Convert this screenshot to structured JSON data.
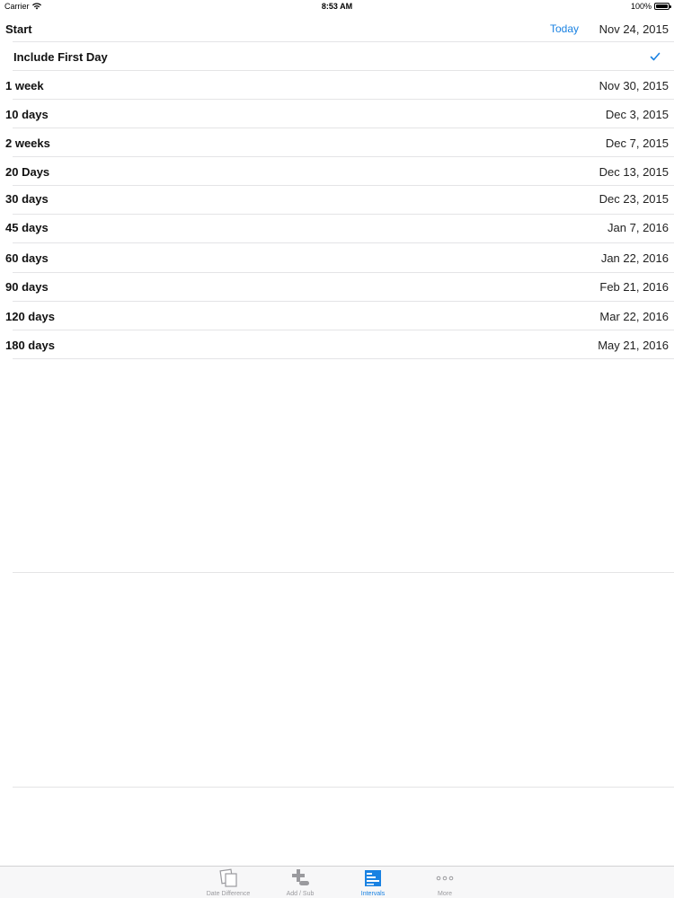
{
  "status_bar": {
    "carrier": "Carrier",
    "time": "8:53 AM",
    "battery": "100%"
  },
  "start_row": {
    "label": "Start",
    "today_button": "Today",
    "date": "Nov 24, 2015"
  },
  "include_first_day": {
    "label": "Include First Day",
    "checked": true
  },
  "intervals": [
    {
      "label": "1 week",
      "date": "Nov 30, 2015"
    },
    {
      "label": "10 days",
      "date": "Dec 3, 2015"
    },
    {
      "label": "2 weeks",
      "date": "Dec 7, 2015"
    },
    {
      "label": "20 Days",
      "date": "Dec 13, 2015"
    },
    {
      "label": "30 days",
      "date": "Dec 23, 2015"
    },
    {
      "label": "45 days",
      "date": "Jan 7, 2016"
    },
    {
      "label": "60 days",
      "date": "Jan 22, 2016"
    },
    {
      "label": "90 days",
      "date": "Feb 21, 2016"
    },
    {
      "label": "120 days",
      "date": "Mar 22, 2016"
    },
    {
      "label": "180 days",
      "date": "May 21, 2016"
    }
  ],
  "tab_bar": {
    "tabs": [
      {
        "label": "Date Difference",
        "icon": "date-difference-icon",
        "active": false
      },
      {
        "label": "Add / Sub",
        "icon": "add-sub-icon",
        "active": false
      },
      {
        "label": "Intervals",
        "icon": "intervals-icon",
        "active": true
      },
      {
        "label": "More",
        "icon": "more-icon",
        "active": false
      }
    ]
  },
  "colors": {
    "accent": "#1a82e2",
    "separator": "#e4e4e6",
    "tab_inactive": "#9a9a9e"
  }
}
